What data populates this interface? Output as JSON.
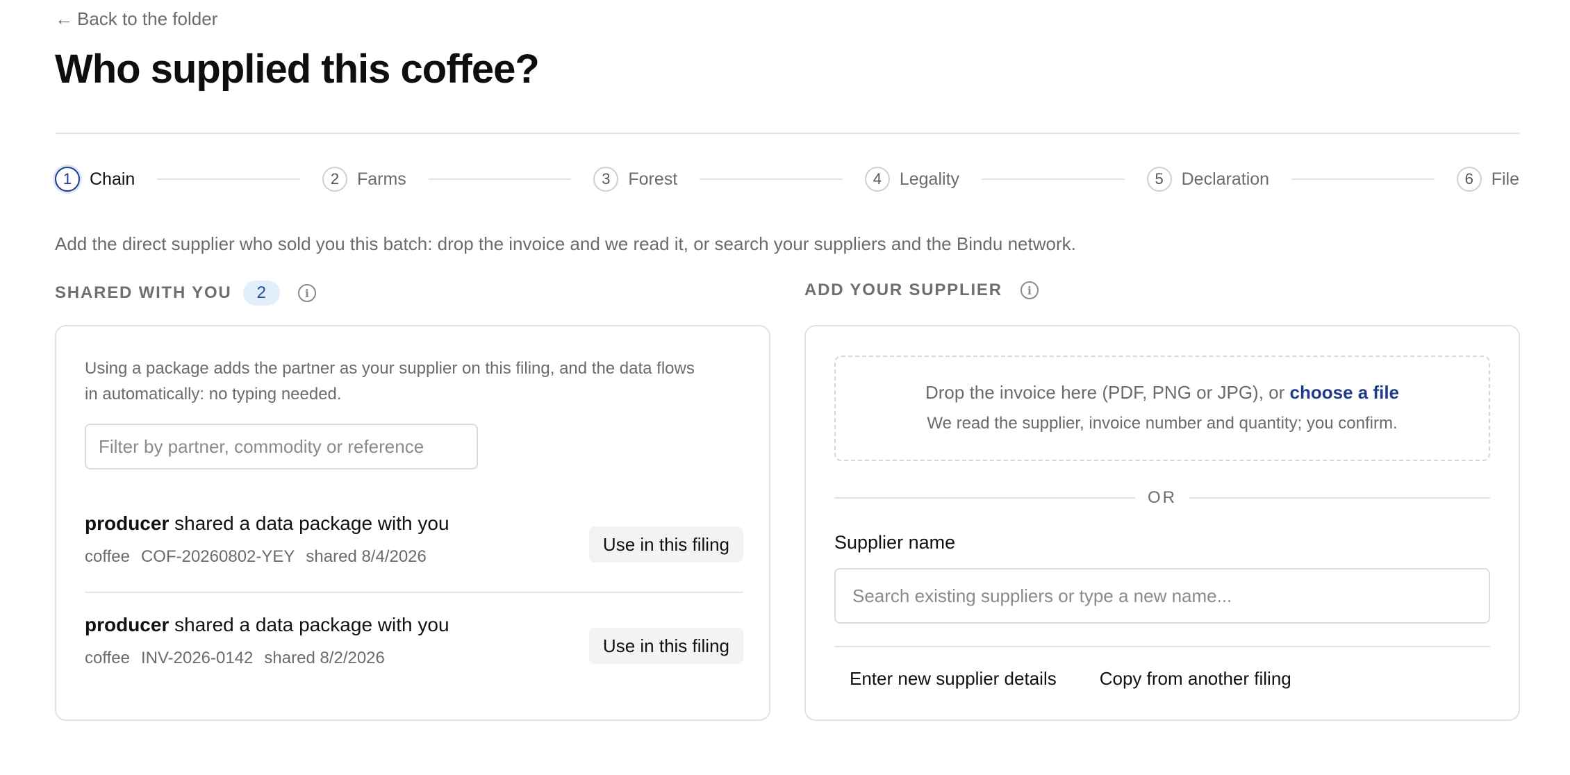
{
  "nav": {
    "back_label": "Back to the folder"
  },
  "page": {
    "title": "Who supplied this coffee?"
  },
  "stepper": {
    "steps": [
      {
        "number": "1",
        "label": "Chain"
      },
      {
        "number": "2",
        "label": "Farms"
      },
      {
        "number": "3",
        "label": "Forest"
      },
      {
        "number": "4",
        "label": "Legality"
      },
      {
        "number": "5",
        "label": "Declaration"
      },
      {
        "number": "6",
        "label": "File"
      }
    ]
  },
  "intro": "Add the direct supplier who sold you this batch: drop the invoice and we read it, or search your suppliers and the Bindu network.",
  "shared": {
    "heading": "SHARED WITH YOU",
    "count": "2",
    "note": "Using a package adds the partner as your supplier on this filing, and the data flows in automatically: no typing needed.",
    "filter_placeholder": "Filter by partner, commodity or reference",
    "packages": [
      {
        "partner": "producer",
        "text": " shared a data package with you",
        "commodity": "coffee",
        "reference": "COF-20260802-YEY",
        "shared": "shared 8/4/2026",
        "button": "Use in this filing"
      },
      {
        "partner": "producer",
        "text": " shared a data package with you",
        "commodity": "coffee",
        "reference": "INV-2026-0142",
        "shared": "shared 8/2/2026",
        "button": "Use in this filing"
      }
    ]
  },
  "add": {
    "heading": "ADD YOUR SUPPLIER",
    "drop_text": "Drop the invoice here (PDF, PNG or JPG), or ",
    "drop_link": "choose a file",
    "drop_sub": "We read the supplier, invoice number and quantity; you confirm.",
    "or": "OR",
    "supplier_label": "Supplier name",
    "supplier_placeholder": "Search existing suppliers or type a new name...",
    "enter_new": "Enter new supplier details",
    "copy_from": "Copy from another filing"
  },
  "colors": {
    "accent": "#1f3b8a",
    "badge_bg": "#e3eefb"
  }
}
